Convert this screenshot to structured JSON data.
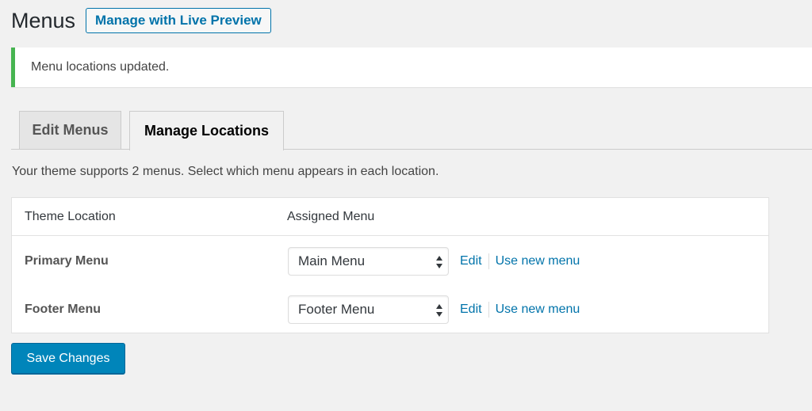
{
  "header": {
    "title": "Menus",
    "live_preview_label": "Manage with Live Preview"
  },
  "notice": {
    "text": "Menu locations updated.",
    "color": "#46b450"
  },
  "tabs": [
    {
      "label": "Edit Menus",
      "active": false
    },
    {
      "label": "Manage Locations",
      "active": true
    }
  ],
  "description": "Your theme supports 2 menus. Select which menu appears in each location.",
  "table": {
    "headers": [
      "Theme Location",
      "Assigned Menu"
    ],
    "rows": [
      {
        "location": "Primary Menu",
        "menu": "Main Menu",
        "edit": "Edit",
        "use_new": "Use new menu"
      },
      {
        "location": "Footer Menu",
        "menu": "Footer Menu",
        "edit": "Edit",
        "use_new": "Use new menu"
      }
    ]
  },
  "save_label": "Save Changes",
  "colors": {
    "accent": "#0073aa",
    "primary_button": "#0085ba"
  }
}
